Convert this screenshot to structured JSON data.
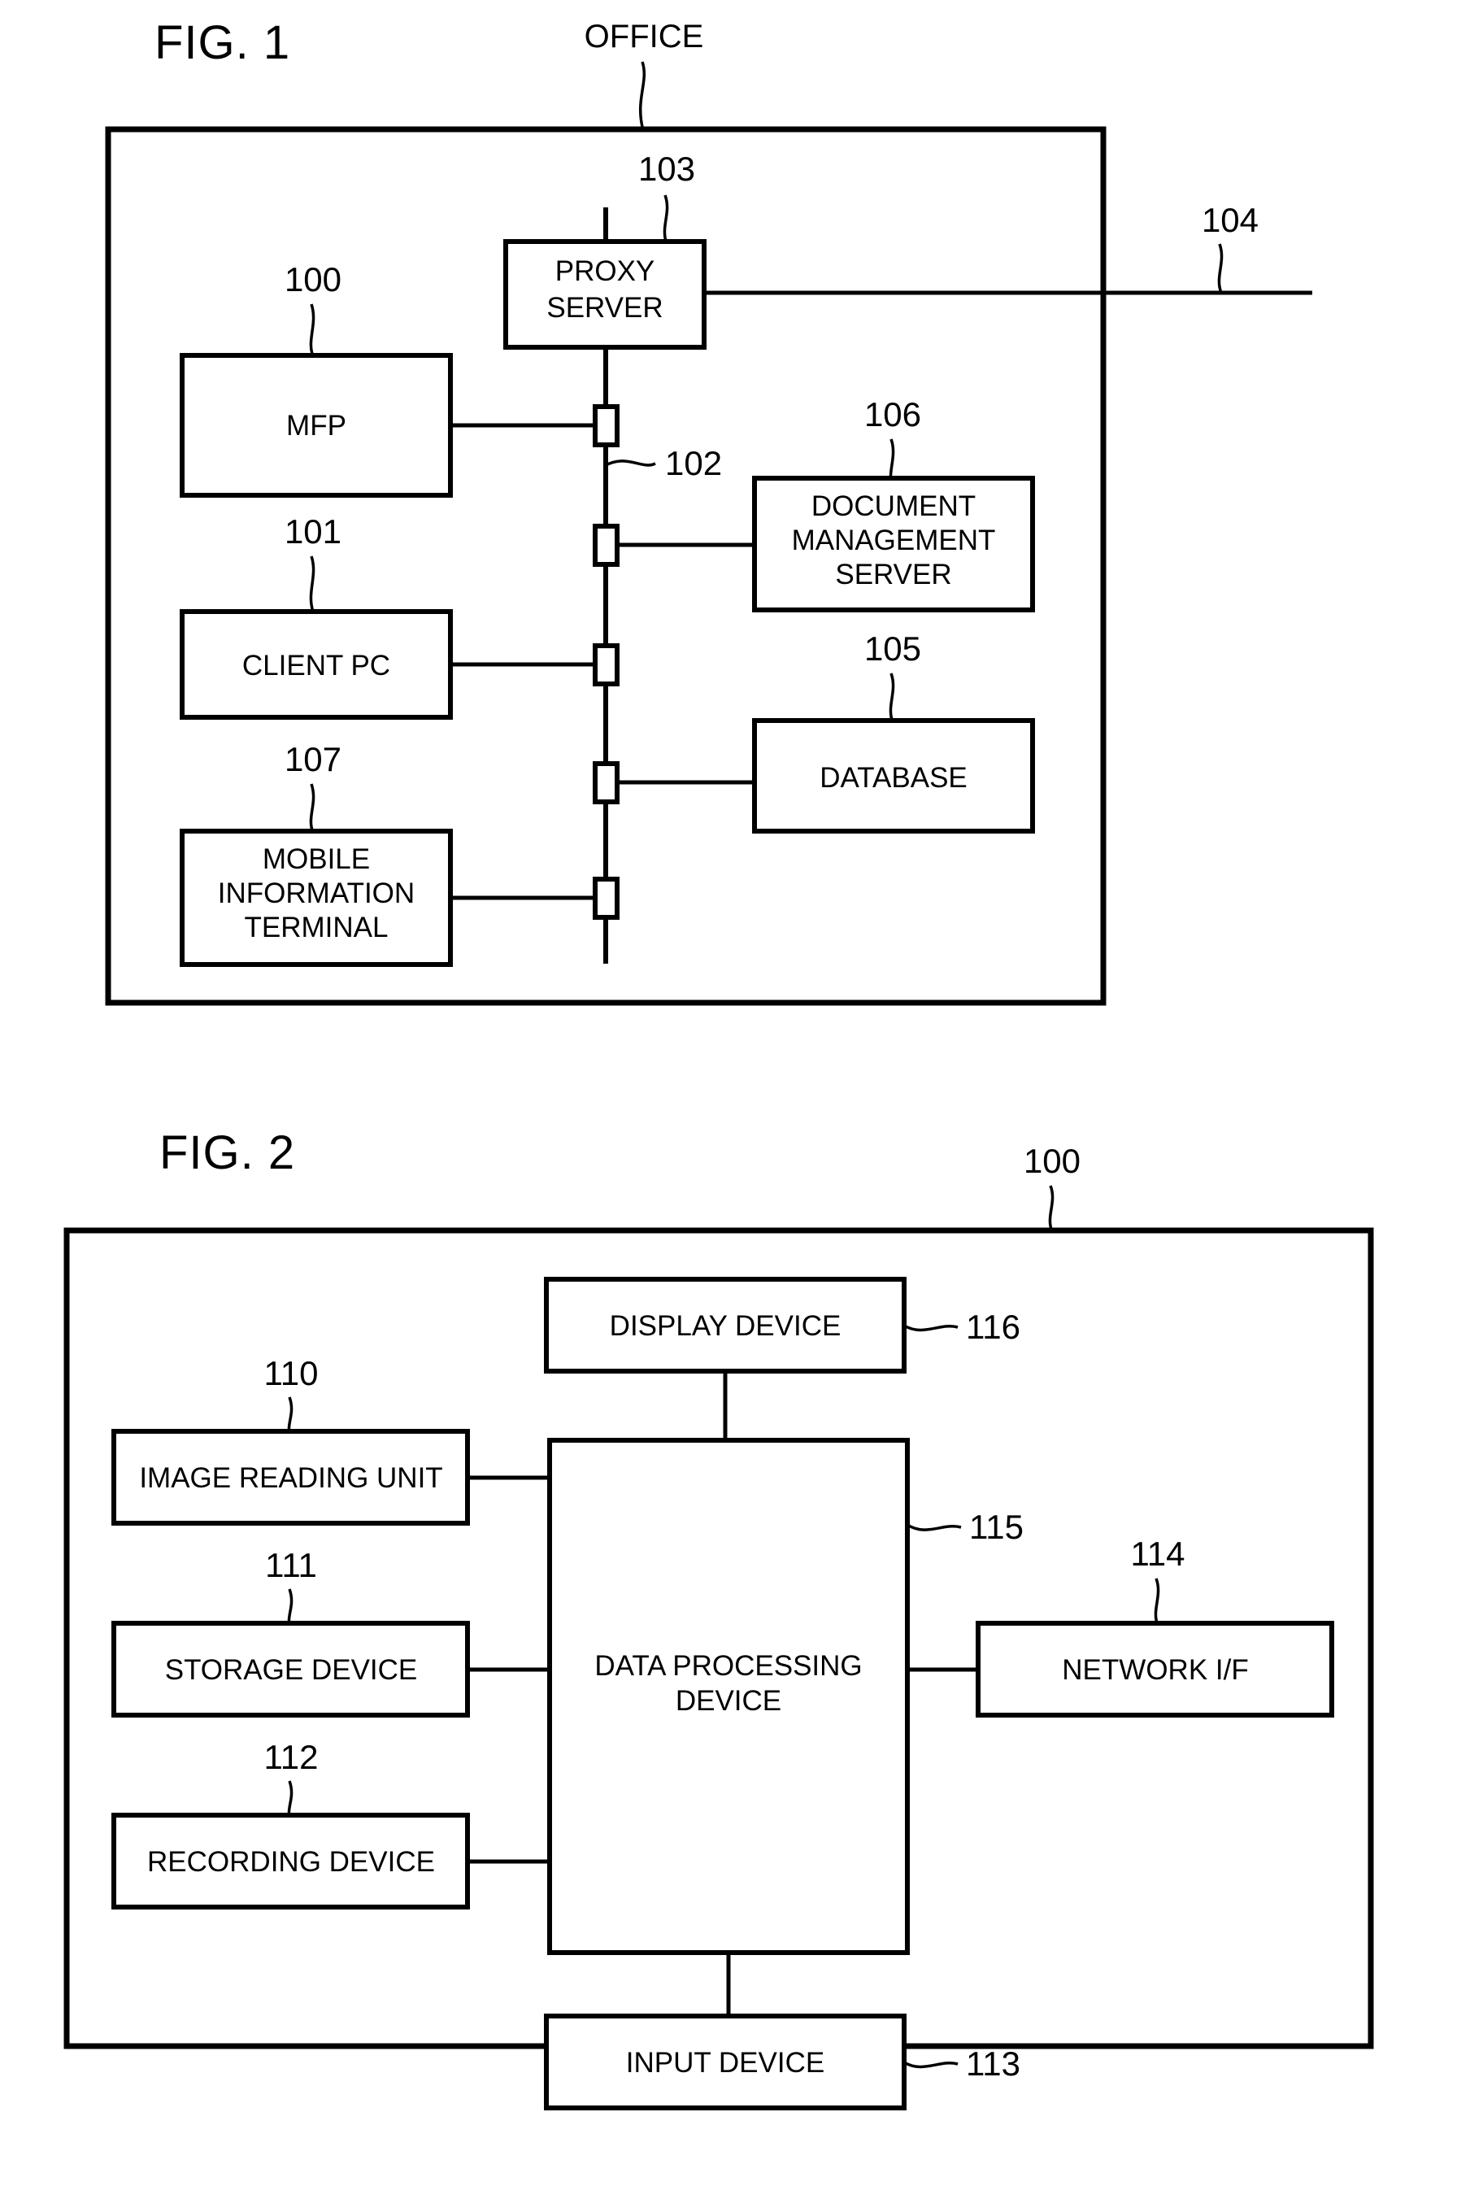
{
  "figures": [
    {
      "id": "fig1",
      "title": "FIG. 1",
      "region_label": "OFFICE",
      "region_ref": "104",
      "bus_ref": "102",
      "boxes": [
        {
          "ref": "103",
          "label": "PROXY SERVER",
          "lines": [
            "PROXY",
            "SERVER"
          ]
        },
        {
          "ref": "100",
          "label": "MFP",
          "lines": [
            "MFP"
          ]
        },
        {
          "ref": "101",
          "label": "CLIENT PC",
          "lines": [
            "CLIENT PC"
          ]
        },
        {
          "ref": "107",
          "label": "MOBILE INFORMATION TERMINAL",
          "lines": [
            "MOBILE",
            "INFORMATION",
            "TERMINAL"
          ]
        },
        {
          "ref": "106",
          "label": "DOCUMENT MANAGEMENT SERVER",
          "lines": [
            "DOCUMENT",
            "MANAGEMENT",
            "SERVER"
          ]
        },
        {
          "ref": "105",
          "label": "DATABASE",
          "lines": [
            "DATABASE"
          ]
        }
      ]
    },
    {
      "id": "fig2",
      "title": "FIG. 2",
      "region_ref": "100",
      "bus_ref": "115",
      "boxes": [
        {
          "ref": "116",
          "label": "DISPLAY DEVICE",
          "lines": [
            "DISPLAY DEVICE"
          ]
        },
        {
          "ref": "110",
          "label": "IMAGE READING UNIT",
          "lines": [
            "IMAGE READING UNIT"
          ]
        },
        {
          "ref": "111",
          "label": "STORAGE DEVICE",
          "lines": [
            "STORAGE DEVICE"
          ]
        },
        {
          "ref": "112",
          "label": "RECORDING DEVICE",
          "lines": [
            "RECORDING DEVICE"
          ]
        },
        {
          "ref": "115",
          "label": "DATA PROCESSING DEVICE",
          "lines": [
            "DATA PROCESSING",
            "DEVICE"
          ]
        },
        {
          "ref": "114",
          "label": "NETWORK I/F",
          "lines": [
            "NETWORK I/F"
          ]
        },
        {
          "ref": "113",
          "label": "INPUT DEVICE",
          "lines": [
            "INPUT DEVICE"
          ]
        }
      ]
    }
  ],
  "fig1": {
    "title": "FIG. 1",
    "office_label": "OFFICE",
    "ref_104": "104",
    "ref_103": "103",
    "ref_102": "102",
    "ref_100": "100",
    "ref_101": "101",
    "ref_107": "107",
    "ref_106": "106",
    "ref_105": "105",
    "proxy_line1": "PROXY",
    "proxy_line2": "SERVER",
    "mfp": "MFP",
    "client_pc": "CLIENT PC",
    "mobile_line1": "MOBILE",
    "mobile_line2": "INFORMATION",
    "mobile_line3": "TERMINAL",
    "dms_line1": "DOCUMENT",
    "dms_line2": "MANAGEMENT",
    "dms_line3": "SERVER",
    "database": "DATABASE"
  },
  "fig2": {
    "title": "FIG. 2",
    "ref_100": "100",
    "ref_116": "116",
    "ref_110": "110",
    "ref_111": "111",
    "ref_112": "112",
    "ref_113": "113",
    "ref_114": "114",
    "ref_115": "115",
    "display_device": "DISPLAY DEVICE",
    "image_reading_unit": "IMAGE READING UNIT",
    "storage_device": "STORAGE DEVICE",
    "recording_device": "RECORDING DEVICE",
    "dpd_line1": "DATA PROCESSING",
    "dpd_line2": "DEVICE",
    "network_if": "NETWORK I/F",
    "input_device": "INPUT DEVICE"
  },
  "colors": {
    "ink": "#000000",
    "paper": "#ffffff"
  }
}
